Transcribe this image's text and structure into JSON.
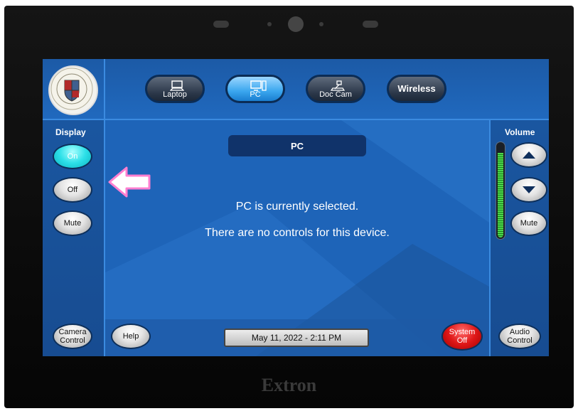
{
  "device": {
    "brand": "Extron"
  },
  "sources": [
    {
      "label": "Laptop",
      "icon": "laptop-icon",
      "active": false
    },
    {
      "label": "PC",
      "icon": "pc-icon",
      "active": true
    },
    {
      "label": "Doc Cam",
      "icon": "document-camera-icon",
      "active": false
    },
    {
      "label": "Wireless",
      "icon": "",
      "active": false
    }
  ],
  "display": {
    "label": "Display",
    "on_label": "On",
    "off_label": "Off",
    "mute_label": "Mute",
    "state": "On"
  },
  "volume": {
    "label": "Volume",
    "mute_label": "Mute",
    "level": 0.9
  },
  "main": {
    "title": "PC",
    "message_line1": "PC is currently selected.",
    "message_line2": "There are no controls for this device."
  },
  "bottom": {
    "camera_control_line1": "Camera",
    "camera_control_line2": "Control",
    "help_label": "Help",
    "datetime": "May 11, 2022  -  2:11 PM",
    "system_off_line1": "System",
    "system_off_line2": "Off",
    "audio_control_line1": "Audio",
    "audio_control_line2": "Control"
  },
  "colors": {
    "screen_bg": "#1e64b8",
    "active_cyan": "#2de0e8",
    "system_off_red": "#e01818",
    "indicator_pink": "#ff7fd0"
  }
}
